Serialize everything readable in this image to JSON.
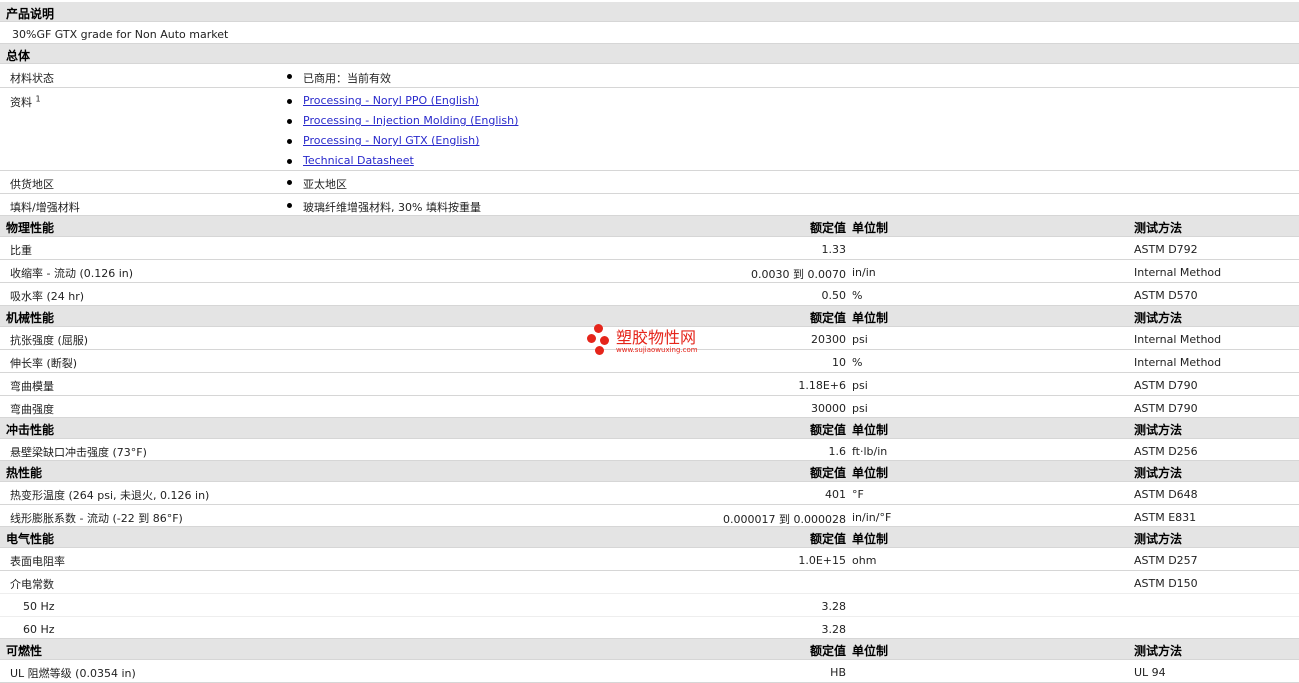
{
  "product": {
    "header": "产品说明",
    "description": "30%GF GTX grade for Non Auto market"
  },
  "general": {
    "header": "总体",
    "status_label": "材料状态",
    "status_value": "已商用：当前有效",
    "docs_label": "资料",
    "docs_sup": "1",
    "docs": [
      "Processing - Noryl PPO (English)",
      "Processing - Injection Molding (English)",
      "Processing - Noryl GTX (English)",
      "Technical Datasheet"
    ],
    "region_label": "供货地区",
    "region_value": "亚太地区",
    "filler_label": "填料/增强材料",
    "filler_value": "玻璃纤维增强材料, 30% 填料按重量"
  },
  "column_headers": {
    "value": "额定值",
    "unit": "单位制",
    "test": "测试方法"
  },
  "physical": {
    "header": "物理性能",
    "rows": [
      {
        "label": "比重",
        "value": "1.33",
        "unit": "",
        "test": "ASTM D792"
      },
      {
        "label": "收缩率  - 流动 (0.126 in)",
        "value": "0.0030 到  0.0070",
        "unit": "in/in",
        "test": "Internal Method"
      },
      {
        "label": "吸水率 (24 hr)",
        "value": "0.50",
        "unit": "%",
        "test": "ASTM D570"
      }
    ]
  },
  "mechanical": {
    "header": "机械性能",
    "rows": [
      {
        "label": "抗张强度 (屈服)",
        "value": "20300",
        "unit": "psi",
        "test": "Internal Method"
      },
      {
        "label": "伸长率 (断裂)",
        "value": "10",
        "unit": "%",
        "test": "Internal Method"
      },
      {
        "label": "弯曲模量",
        "value": "1.18E+6",
        "unit": "psi",
        "test": "ASTM D790"
      },
      {
        "label": "弯曲强度",
        "value": "30000",
        "unit": "psi",
        "test": "ASTM D790"
      }
    ]
  },
  "impact": {
    "header": "冲击性能",
    "rows": [
      {
        "label": "悬壁梁缺口冲击强度 (73°F)",
        "value": "1.6",
        "unit": "ft·lb/in",
        "test": "ASTM D256"
      }
    ]
  },
  "thermal": {
    "header": "热性能",
    "rows": [
      {
        "label": "热变形温度 (264 psi, 未退火, 0.126 in)",
        "value": "401",
        "unit": "°F",
        "test": "ASTM D648"
      },
      {
        "label": "线形膨胀系数 - 流动 (-22 到  86°F)",
        "value": "0.000017 到  0.000028",
        "unit": "in/in/°F",
        "test": "ASTM E831"
      }
    ]
  },
  "electrical": {
    "header": "电气性能",
    "rows": [
      {
        "label": "表面电阻率",
        "value": "1.0E+15",
        "unit": "ohm",
        "test": "ASTM D257"
      },
      {
        "label": "介电常数",
        "value": "",
        "unit": "",
        "test": "ASTM D150"
      }
    ],
    "sub_rows": [
      {
        "label": "50 Hz",
        "value": "3.28"
      },
      {
        "label": "60 Hz",
        "value": "3.28"
      }
    ]
  },
  "flammability": {
    "header": "可燃性",
    "rows": [
      {
        "label": "UL 阻燃等级 (0.0354 in)",
        "value": "HB",
        "unit": "",
        "test": "UL 94"
      }
    ]
  },
  "watermark": {
    "title": "塑胶物性网",
    "url": "www.sujiaowuxing.com",
    "color": "#e5251b"
  }
}
